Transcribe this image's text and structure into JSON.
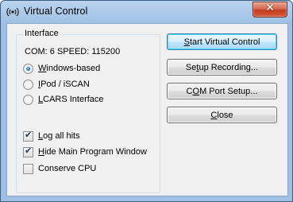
{
  "window": {
    "title": "Virtual Control",
    "close_glyph": "✕",
    "icon": "wireless-signal-icon"
  },
  "interface": {
    "group_label": "Interface",
    "com_line": "COM: 6  SPEED: 115200",
    "radios": [
      {
        "label": "Windows-based",
        "accel": "W",
        "rest": "indows-based",
        "checked": true
      },
      {
        "label": "IPod / iSCAN",
        "accel": "I",
        "rest": "Pod / iSCAN",
        "checked": false
      },
      {
        "label": "LCARS Interface",
        "accel": "L",
        "rest": "CARS Interface",
        "checked": false
      }
    ],
    "checkboxes": [
      {
        "label": "Log all hits",
        "accel": "L",
        "rest": "og all hits",
        "checked": true
      },
      {
        "label": "Hide Main Program Window",
        "accel": "H",
        "rest": "ide Main Program Window",
        "checked": true
      },
      {
        "label": "Conserve CPU",
        "accel": "",
        "rest": "Conserve CPU",
        "checked": false
      }
    ]
  },
  "buttons": {
    "start": {
      "pre": "",
      "accel": "S",
      "post": "tart Virtual Control"
    },
    "setup_recording": {
      "pre": "Se",
      "accel": "t",
      "post": "up Recording..."
    },
    "com_port": {
      "pre": "C",
      "accel": "O",
      "post": "M Port Setup..."
    },
    "close": {
      "pre": "",
      "accel": "C",
      "post": "lose"
    }
  },
  "check_glyph": "✔"
}
